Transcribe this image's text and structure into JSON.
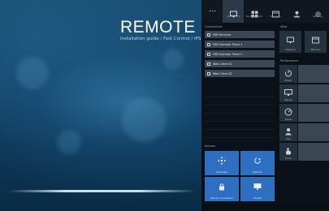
{
  "hero": {
    "title": "REMOTE HM",
    "subtitle": "Installation guide / Fast Control / IPS"
  },
  "panel": {
    "tabs": [
      {
        "icon": "dots-icon",
        "label": ""
      },
      {
        "icon": "monitor-icon",
        "label": "Dashboard"
      },
      {
        "icon": "grid-icon",
        "label": "Remote Desk"
      },
      {
        "icon": "window-icon",
        "label": "Windows"
      },
      {
        "icon": "user-icon",
        "label": "Users"
      },
      {
        "icon": "gear-icon",
        "label": "Settings"
      }
    ],
    "list_header": "Connections",
    "list_items": [
      "HMI Terminal",
      "HMI Operator Panel 1",
      "HMI Operator Panel 2",
      "Web Client 01",
      "Web Client 02"
    ],
    "actions_header": "Actions",
    "tiles": [
      {
        "icon": "move-icon",
        "label": "Controller"
      },
      {
        "icon": "sync-icon",
        "label": "Refresh"
      },
      {
        "icon": "lock-icon",
        "label": "Secure connection"
      },
      {
        "icon": "display-icon",
        "label": "Screen"
      }
    ],
    "right_header": "View",
    "squares": [
      {
        "icon": "desktop-icon",
        "label": "Desktop"
      },
      {
        "icon": "window-icon",
        "label": "Window"
      }
    ],
    "perf_header": "Performance",
    "wide_items": [
      {
        "icon": "power-icon",
        "label": "Power"
      },
      {
        "icon": "screen-icon",
        "label": "Display"
      },
      {
        "icon": "speed-icon",
        "label": "Speed"
      },
      {
        "icon": "person-icon",
        "label": "User"
      },
      {
        "icon": "hand-icon",
        "label": "Touch"
      }
    ]
  }
}
